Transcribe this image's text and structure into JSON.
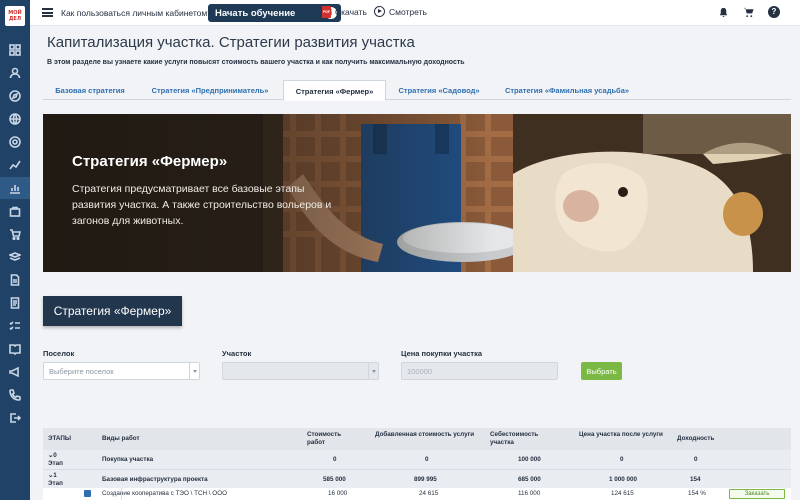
{
  "topbar": {
    "question": "Как пользоваться личным кабинетом?",
    "train_button": "Начать обучение",
    "train_info": "i",
    "download": "Скачать",
    "watch": "Смотреть",
    "help": "?",
    "pdf_label": "PDF"
  },
  "logo": {
    "line1": "МОЙ",
    "line2": "ДЕЛ"
  },
  "sidebar": {
    "icons": [
      "dashboard-icon",
      "user-icon",
      "compass-icon",
      "globe-icon",
      "target-icon",
      "chart-line-icon",
      "chart-bar-icon",
      "bag-icon",
      "cart-icon",
      "layers-icon",
      "document-icon",
      "list-icon",
      "checklist-icon",
      "book-icon",
      "megaphone-icon",
      "phone-icon",
      "logout-icon"
    ],
    "active_index": 6
  },
  "page": {
    "title": "Капитализация участка. Стратегии развития участка",
    "subtitle": "В этом разделе вы узнаете какие услуги повысят стоимость вашего участка и как получить максимальную доходность"
  },
  "tabs": [
    {
      "label": "Базовая стратегия"
    },
    {
      "label": "Стратегия «Предприниматель»"
    },
    {
      "label": "Стратегия «Фермер»"
    },
    {
      "label": "Стратегия «Садовод»"
    },
    {
      "label": "Стратегия «Фамильная усадьба»"
    }
  ],
  "active_tab": 2,
  "hero": {
    "title": "Стратегия «Фермер»",
    "text": "Стратегия предусматривает все базовые этапы развития участка. А также строительство вольеров и загонов для животных."
  },
  "strategy_chip": "Стратегия «Фермер»",
  "filters": {
    "settlement_label": "Поселок",
    "settlement_placeholder": "Выберите поселок",
    "plot_label": "Участок",
    "plot_value": "",
    "price_label": "Цена покупки участка",
    "price_placeholder": "100000",
    "choose_button": "Выбрать"
  },
  "table": {
    "headers": {
      "stages": "ЭТАПЫ",
      "works": "Виды работ",
      "cost": "Стоимость работ",
      "added": "Добавленная стоимость услуги",
      "self_cost": "Себестоимость участка",
      "price_after": "Цена участка после услуги",
      "profit": "Доходность"
    },
    "rows": [
      {
        "stage_num": "0",
        "stage_word": "Этап",
        "work": "Покупка участка",
        "cost": "0",
        "added": "0",
        "self_cost": "100 000",
        "price_after": "0",
        "profit": "0"
      },
      {
        "stage_num": "1",
        "stage_word": "Этап",
        "work": "Базовая инфраструктура проекта",
        "cost": "585 000",
        "added": "899 995",
        "self_cost": "685 000",
        "price_after": "1 000 000",
        "profit": "154"
      },
      {
        "work": "Создание кооператива с ТЭО \\ ТСН \\ ООО",
        "cost": "16 000",
        "added": "24 615",
        "self_cost": "116 000",
        "price_after": "124 615",
        "profit": "154 %",
        "action": "Заказать"
      }
    ]
  },
  "colors": {
    "sidebar": "#1f4266",
    "accent_blue": "#2f6fb0",
    "chip": "#22364d",
    "green": "#7bb944"
  }
}
